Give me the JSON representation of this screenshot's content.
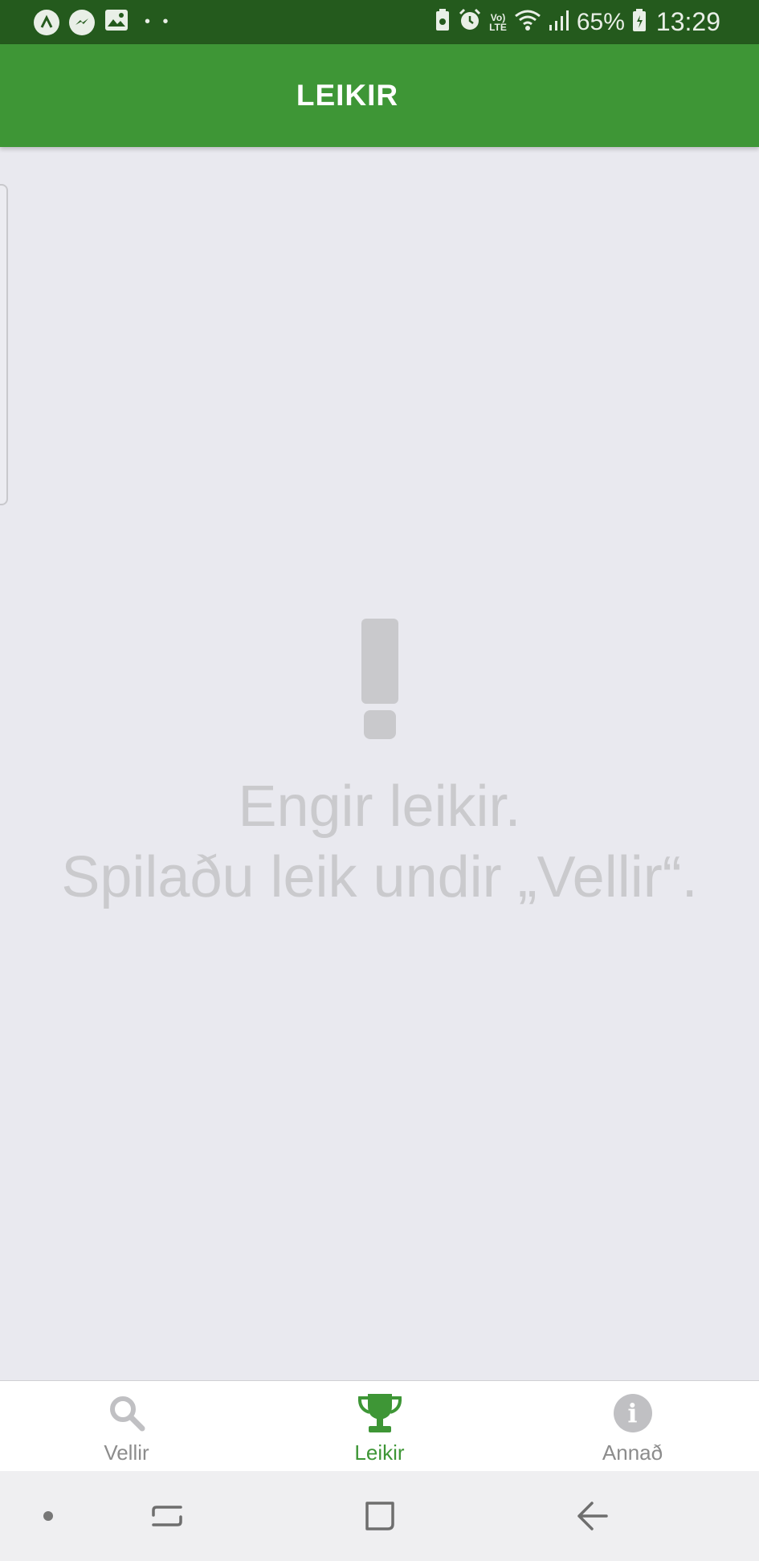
{
  "status_bar": {
    "battery_percent": "65%",
    "time": "13:29",
    "volte_top": "Vo)",
    "volte_bottom": "LTE",
    "dots": "• •",
    "left_icons": [
      "app-a-icon",
      "messenger-icon",
      "gallery-icon"
    ],
    "right_icons": [
      "battery-saver-icon",
      "alarm-icon",
      "volte-icon",
      "wifi-icon",
      "signal-icon",
      "battery-icon"
    ]
  },
  "app_bar": {
    "title": "LEIKIR",
    "color": "#3e9636"
  },
  "empty_state": {
    "icon": "exclamation-icon",
    "line1": "Engir leikir.",
    "line2": "Spilaðu leik undir „Vellir“."
  },
  "tab_bar": {
    "tabs": [
      {
        "label": "Vellir",
        "icon": "search-icon",
        "active": false
      },
      {
        "label": "Leikir",
        "icon": "trophy-icon",
        "active": true
      },
      {
        "label": "Annað",
        "icon": "info-icon",
        "active": false
      }
    ],
    "active_color": "#3e9636",
    "inactive_color": "#8c8c8c"
  },
  "nav_bar": {
    "buttons": [
      "nav-dot-icon",
      "recents-icon",
      "home-icon",
      "back-icon"
    ]
  }
}
